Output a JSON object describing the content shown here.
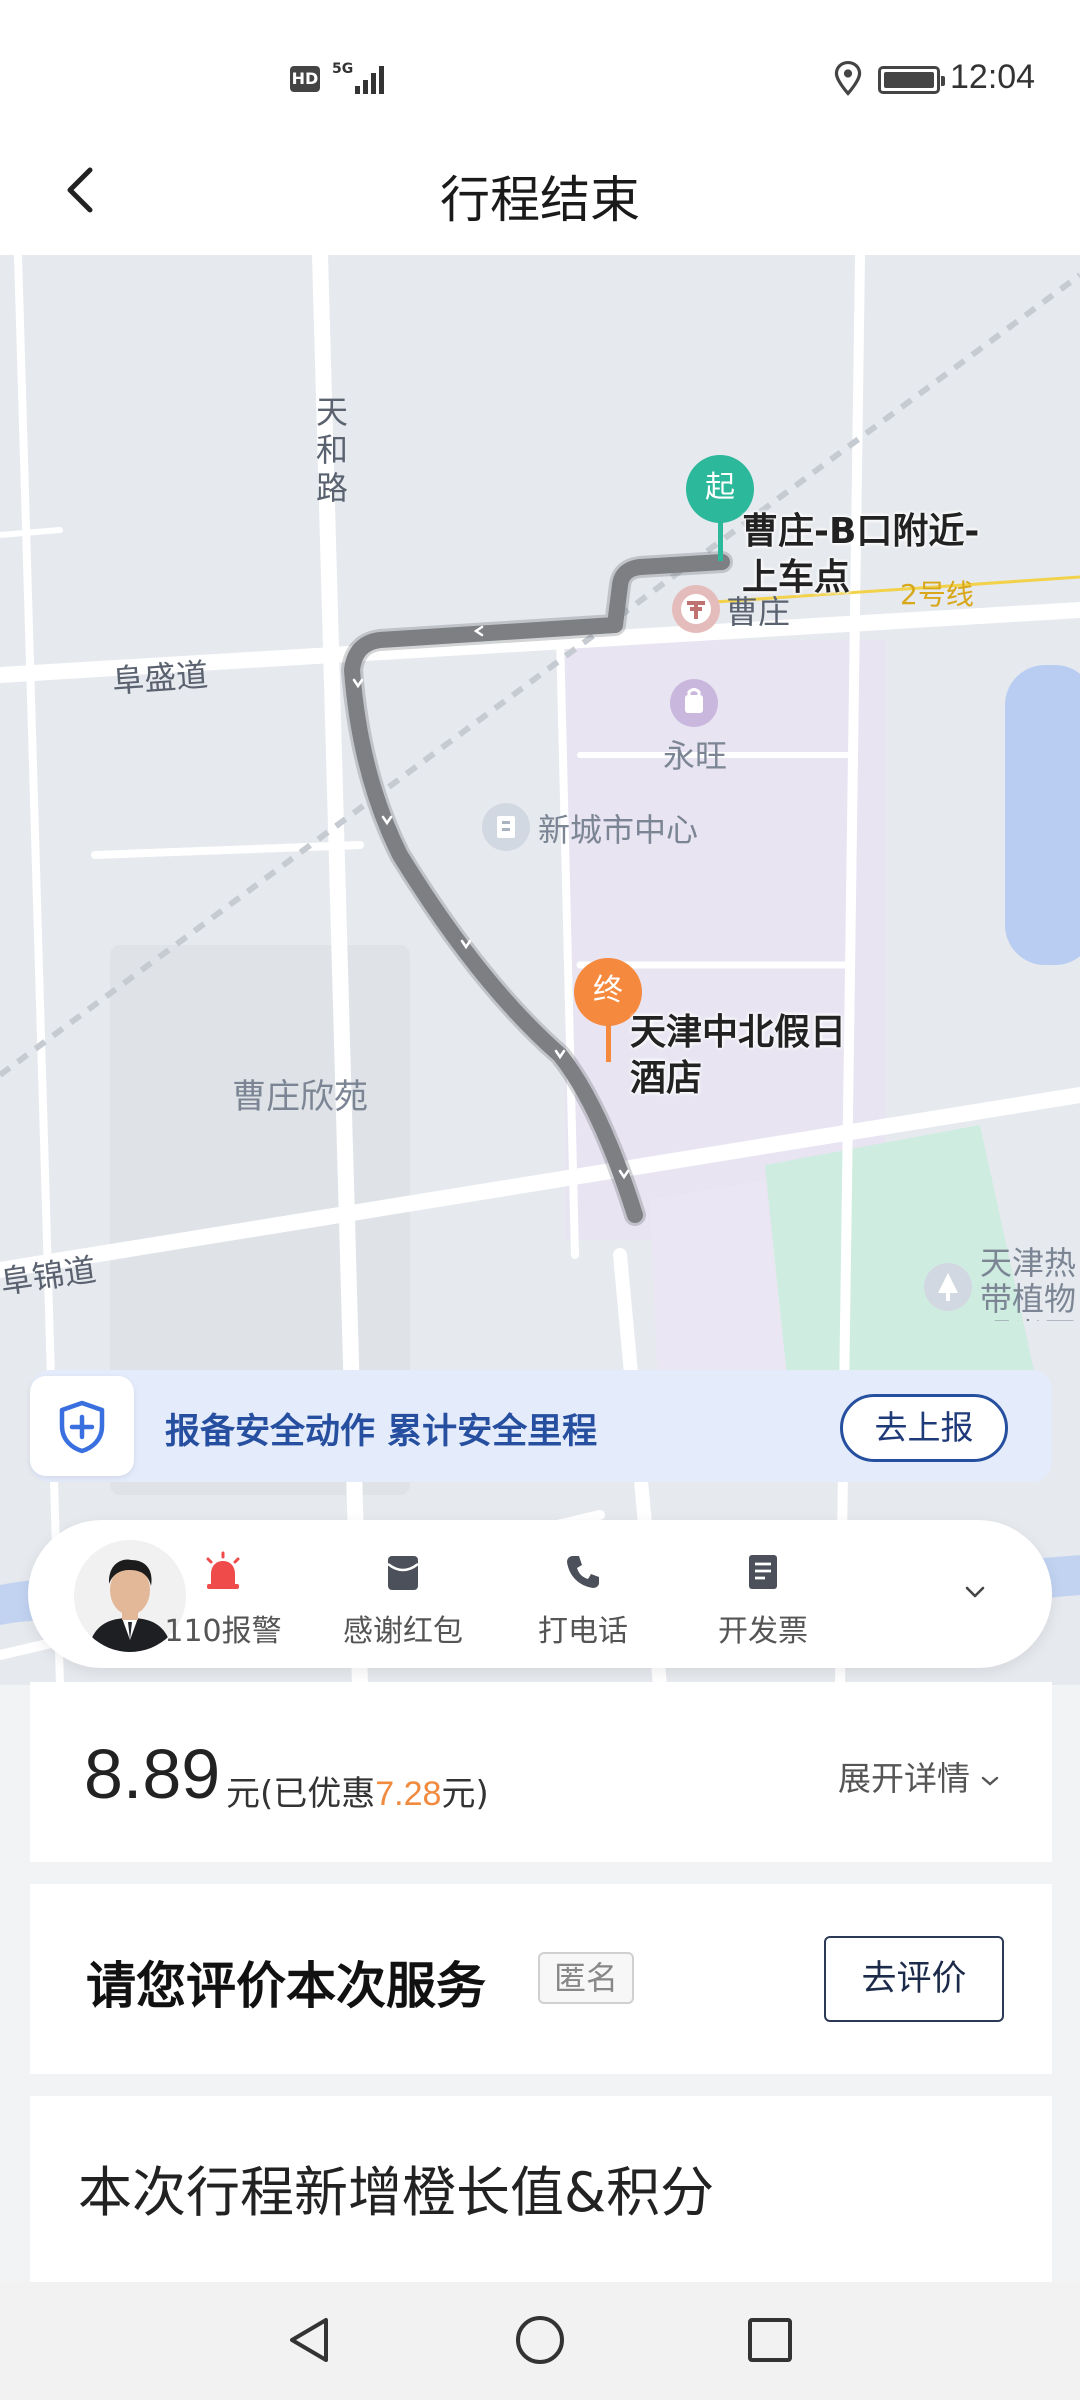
{
  "status_bar": {
    "hd": "HD",
    "network": "5G",
    "time": "12:04"
  },
  "header": {
    "title": "行程结束"
  },
  "map": {
    "roads": [
      "天和路",
      "阜盛道",
      "阜锦道"
    ],
    "subway_line": "2号线",
    "pois": [
      "曹庄",
      "永旺",
      "新城市中心",
      "曹庄欣苑",
      "天津热带植物观光园"
    ],
    "poi_edge_text": "半",
    "start": {
      "badge": "起",
      "label": "曹庄-B口附近-上车点"
    },
    "end": {
      "badge": "终",
      "label": "天津中北假日酒店"
    }
  },
  "safety": {
    "text": "报备安全动作 累计安全里程",
    "button": "去上报"
  },
  "actions": [
    {
      "label": "110报警",
      "icon": "alarm-icon"
    },
    {
      "label": "感谢红包",
      "icon": "red-envelope-icon"
    },
    {
      "label": "打电话",
      "icon": "phone-icon"
    },
    {
      "label": "开发票",
      "icon": "invoice-icon"
    }
  ],
  "fare": {
    "amount": "8.89",
    "unit_prefix": "元(已优惠",
    "discount": "7.28",
    "unit_suffix": "元)",
    "expand": "展开详情"
  },
  "rating": {
    "title": "请您评价本次服务",
    "anonymous": "匿名",
    "button": "去评价"
  },
  "growth": {
    "title": "本次行程新增橙长值&积分"
  },
  "colors": {
    "start_pin": "#2cb89a",
    "end_pin": "#f5893d",
    "route": "#7d7f83",
    "accent_blue": "#264fa0",
    "discount": "#f08a3e"
  }
}
